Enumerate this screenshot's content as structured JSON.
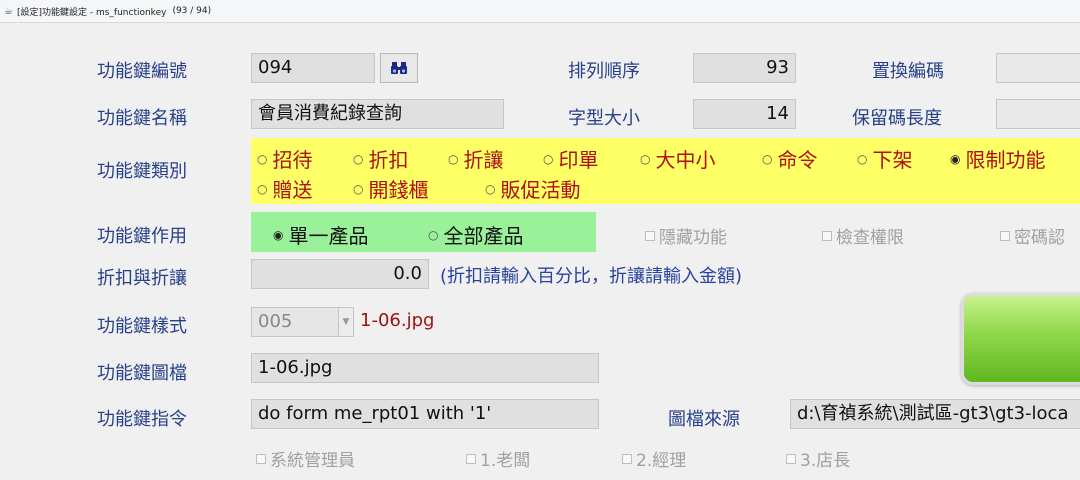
{
  "window": {
    "title": "[設定]功能鍵設定 - ms_functionkey",
    "record_count": "(93 / 94)"
  },
  "labels": {
    "key_no": "功能鍵編號",
    "sort_order": "排列順序",
    "replace_code": "置換編碼",
    "key_name": "功能鍵名稱",
    "font_size": "字型大小",
    "reserve_len": "保留碼長度",
    "key_category": "功能鍵類別",
    "key_effect": "功能鍵作用",
    "discount": "折扣與折讓",
    "key_style": "功能鍵樣式",
    "key_image": "功能鍵圖檔",
    "key_command": "功能鍵指令",
    "image_source": "圖檔來源"
  },
  "fields": {
    "key_no": "094",
    "sort_order": "93",
    "replace_code": "",
    "key_name": "會員消費紀錄查詢",
    "font_size": "14",
    "reserve_len": "",
    "discount": "0.0",
    "key_style": "005",
    "key_image": "1-06.jpg",
    "key_command": "do form me_rpt01 with '1'",
    "image_source": "d:\\育禎系統\\測試區-gt3\\gt3-loca"
  },
  "style_filename": "1-06.jpg",
  "discount_hint": "(折扣請輸入百分比，折讓請輸入金額)",
  "category_options": [
    {
      "label": "招待",
      "selected": false
    },
    {
      "label": "折扣",
      "selected": false
    },
    {
      "label": "折讓",
      "selected": false
    },
    {
      "label": "印單",
      "selected": false
    },
    {
      "label": "大中小",
      "selected": false
    },
    {
      "label": "命令",
      "selected": false
    },
    {
      "label": "下架",
      "selected": false
    },
    {
      "label": "限制功能",
      "selected": true
    },
    {
      "label": "贈送",
      "selected": false
    },
    {
      "label": "開錢櫃",
      "selected": false
    },
    {
      "label": "販促活動",
      "selected": false
    }
  ],
  "effect_options": [
    {
      "label": "單一產品",
      "selected": true
    },
    {
      "label": "全部產品",
      "selected": false
    }
  ],
  "checkboxes": {
    "hide_function": "隱藏功能",
    "check_permission": "檢查權限",
    "password_auth": "密碼認",
    "sys_admin": "系統管理員",
    "boss": "1.老闆",
    "manager": "2.經理",
    "store_head": "3.店長"
  },
  "colors": {
    "label_blue": "#27408b",
    "option_red": "#b01010",
    "yellow_panel": "#ffff66",
    "green_panel": "#99f299"
  }
}
